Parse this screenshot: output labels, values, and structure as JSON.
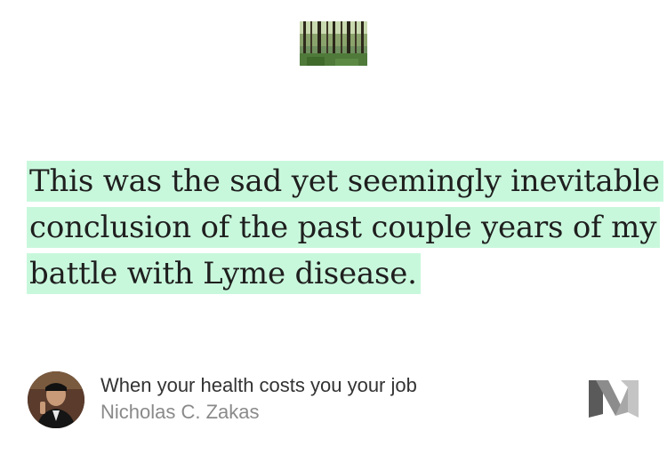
{
  "header_image": {
    "icon": "forest-photo-icon"
  },
  "quote": {
    "lines": [
      "This was the sad yet seemingly inevitable",
      "conclusion of the past couple years of my",
      "battle with Lyme disease."
    ],
    "highlight_color": "#c8f8dc"
  },
  "footer": {
    "avatar_icon": "author-avatar-icon",
    "title": "When your health costs you your job",
    "author": "Nicholas C. Zakas",
    "logo_icon": "medium-logo-icon"
  }
}
